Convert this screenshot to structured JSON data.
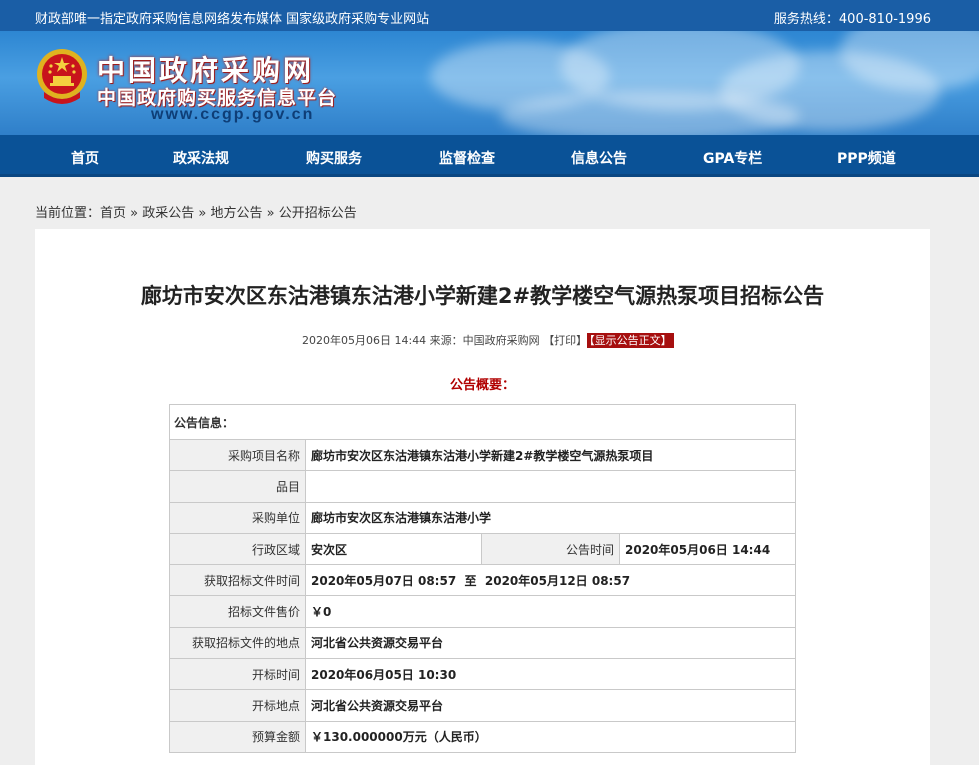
{
  "topbar": {
    "slogan": "财政部唯一指定政府采购信息网络发布媒体 国家级政府采购专业网站",
    "hotline": "服务热线：400-810-1996"
  },
  "brand": {
    "name_cn": "中国政府采购网",
    "subtitle": "中国政府购买服务信息平台",
    "url": "www.ccgp.gov.cn"
  },
  "nav": [
    "首页",
    "政采法规",
    "购买服务",
    "监督检查",
    "信息公告",
    "GPA专栏",
    "PPP频道"
  ],
  "breadcrumb": {
    "prefix": "当前位置：",
    "items": [
      "首页",
      "政采公告",
      "地方公告",
      "公开招标公告"
    ],
    "sep": " » "
  },
  "article": {
    "title": "廊坊市安次区东沽港镇东沽港小学新建2#教学楼空气源热泵项目招标公告",
    "meta_text": "2020年05月06日 14:44 来源：中国政府采购网 ",
    "print_label": "【打印】",
    "show_label": "【显示公告正文】",
    "overview_label": "公告概要："
  },
  "info_table": {
    "header": "公告信息：",
    "rows": [
      {
        "label": "采购项目名称",
        "value": "廊坊市安次区东沽港镇东沽港小学新建2#教学楼空气源热泵项目"
      },
      {
        "label": "品目",
        "value": ""
      },
      {
        "label": "采购单位",
        "value": "廊坊市安次区东沽港镇东沽港小学"
      },
      {
        "label": "行政区域",
        "value": "安次区",
        "label2": "公告时间",
        "value2": "2020年05月06日 14:44"
      },
      {
        "label": "获取招标文件时间",
        "value": "2020年05月07日 08:57  至  2020年05月12日 08:57"
      },
      {
        "label": "招标文件售价",
        "value": "￥0"
      },
      {
        "label": "获取招标文件的地点",
        "value": "河北省公共资源交易平台"
      },
      {
        "label": "开标时间",
        "value": "2020年06月05日 10:30"
      },
      {
        "label": "开标地点",
        "value": "河北省公共资源交易平台"
      },
      {
        "label": "预算金额",
        "value": "￥130.000000万元（人民币）"
      }
    ]
  },
  "colors": {
    "topbar": "#1a5ea6",
    "nav": "#0a5297",
    "accent_red": "#a60f0f"
  }
}
